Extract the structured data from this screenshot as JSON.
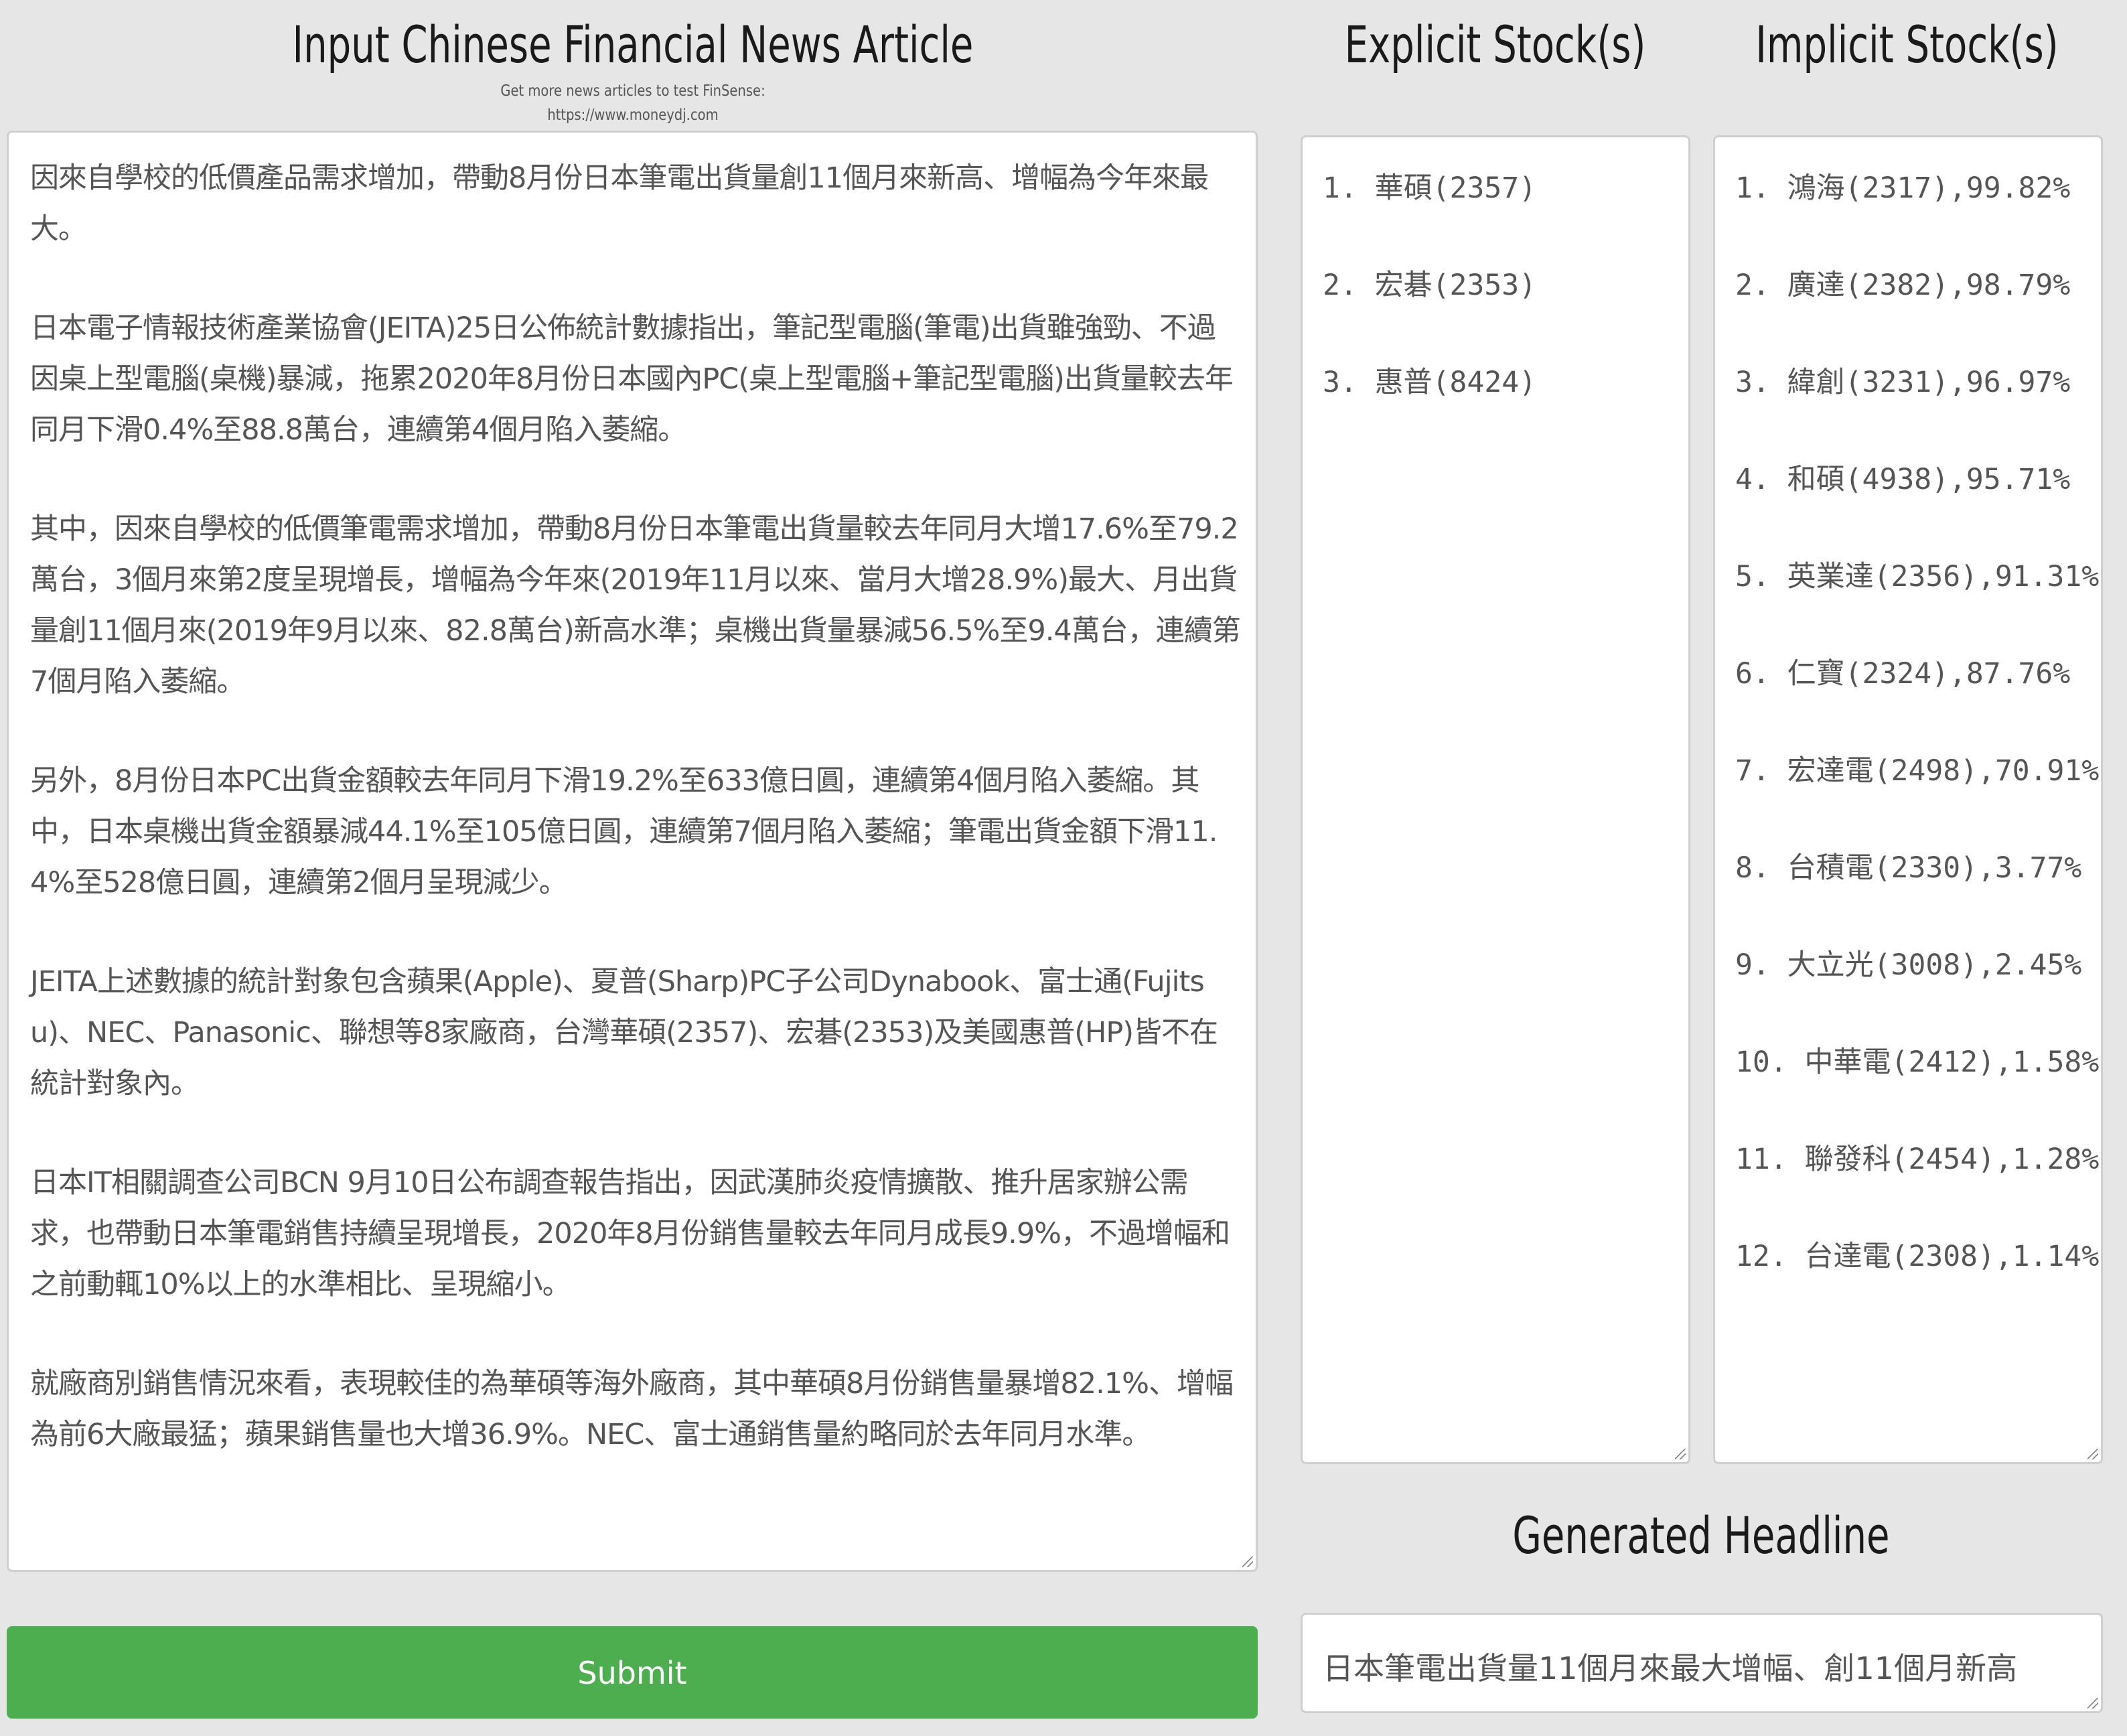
{
  "headings": {
    "input": "Input Chinese Financial News Article",
    "explicit": "Explicit Stock(s)",
    "implicit": "Implicit Stock(s)",
    "headline": "Generated Headline"
  },
  "note": {
    "line1": "Get more news articles to test FinSense:",
    "line2": "https://www.moneydj.com"
  },
  "article": {
    "paragraphs": [
      "因來自學校的低價產品需求增加，帶動8月份日本筆電出貨量創11個月來新高、增幅為今年來最大。",
      "日本電子情報技術產業協會(JEITA)25日公佈統計數據指出，筆記型電腦(筆電)出貨雖強勁、不過因桌上型電腦(桌機)暴減，拖累2020年8月份日本國內PC(桌上型電腦+筆記型電腦)出貨量較去年同月下滑0.4%至88.8萬台，連續第4個月陷入萎縮。",
      "其中，因來自學校的低價筆電需求增加，帶動8月份日本筆電出貨量較去年同月大增17.6%至79.2萬台，3個月來第2度呈現增長，增幅為今年來(2019年11月以來、當月大增28.9%)最大、月出貨量創11個月來(2019年9月以來、82.8萬台)新高水準；桌機出貨量暴減56.5%至9.4萬台，連續第7個月陷入萎縮。",
      "另外，8月份日本PC出貨金額較去年同月下滑19.2%至633億日圓，連續第4個月陷入萎縮。其中，日本桌機出貨金額暴減44.1%至105億日圓，連續第7個月陷入萎縮；筆電出貨金額下滑11.4%至528億日圓，連續第2個月呈現減少。",
      "JEITA上述數據的統計對象包含蘋果(Apple)、夏普(Sharp)PC子公司Dynabook、富士通(Fujitsu)、NEC、Panasonic、聯想等8家廠商，台灣華碩(2357)、宏碁(2353)及美國惠普(HP)皆不在統計對象內。",
      "日本IT相關調查公司BCN 9月10日公布調查報告指出，因武漢肺炎疫情擴散、推升居家辦公需求，也帶動日本筆電銷售持續呈現增長，2020年8月份銷售量較去年同月成長9.9%，不過增幅和之前動輒10%以上的水準相比、呈現縮小。",
      "就廠商別銷售情況來看，表現較佳的為華碩等海外廠商，其中華碩8月份銷售量暴增82.1%、增幅為前6大廠最猛；蘋果銷售量也大增36.9%。NEC、富士通銷售量約略同於去年同月水準。"
    ]
  },
  "explicit_stocks": [
    "1. 華碩(2357)",
    "2. 宏碁(2353)",
    "3. 惠普(8424)"
  ],
  "implicit_stocks": [
    "1. 鴻海(2317),99.82%",
    "2. 廣達(2382),98.79%",
    "3. 緯創(3231),96.97%",
    "4. 和碩(4938),95.71%",
    "5. 英業達(2356),91.31%",
    "6. 仁寶(2324),87.76%",
    "7. 宏達電(2498),70.91%",
    "8. 台積電(2330),3.77%",
    "9. 大立光(3008),2.45%",
    "10. 中華電(2412),1.58%",
    "11. 聯發科(2454),1.28%",
    "12. 台達電(2308),1.14%"
  ],
  "headline": {
    "text": "日本筆電出貨量11個月來最大增幅、創11個月新高"
  },
  "submit": {
    "label": "Submit",
    "color": "#4cae4f"
  }
}
